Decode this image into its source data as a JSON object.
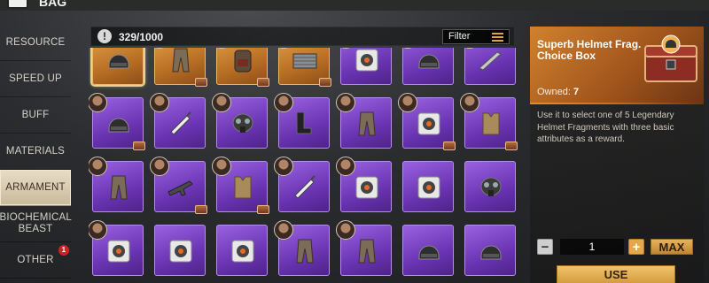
{
  "header": {
    "title_fragment": "BAG"
  },
  "sidebar": {
    "categories": [
      {
        "label": "RESOURCE",
        "active": false
      },
      {
        "label": "SPEED UP",
        "active": false
      },
      {
        "label": "BUFF",
        "active": false
      },
      {
        "label": "MATERIALS",
        "active": false
      },
      {
        "label": "ARMAMENT",
        "active": true
      },
      {
        "label": "BIOCHEMICAL BEAST",
        "active": false
      },
      {
        "label": "OTHER",
        "active": false,
        "badge": "1"
      }
    ]
  },
  "inventory": {
    "capacity": "329/1000",
    "filter_label": "Filter",
    "grid": {
      "rows": [
        [
          {
            "rarity": "orange",
            "item": "helmet-icon",
            "selected": true
          },
          {
            "rarity": "orange",
            "item": "trousers-icon",
            "hero": true,
            "chest": true
          },
          {
            "rarity": "orange",
            "item": "backpack-icon",
            "hero": true,
            "chest": true
          },
          {
            "rarity": "orange",
            "item": "crate-icon",
            "hero": true,
            "chest": true
          },
          {
            "rarity": "purple",
            "item": "fragment-box-icon",
            "hero": true
          },
          {
            "rarity": "purple",
            "item": "helmet-icon",
            "hero": true
          },
          {
            "rarity": "purple",
            "item": "blade-icon",
            "hero": true
          }
        ],
        [
          {
            "rarity": "purple",
            "item": "helmet-icon",
            "hero": true,
            "chest": true
          },
          {
            "rarity": "purple",
            "item": "syringe-icon",
            "hero": true
          },
          {
            "rarity": "purple",
            "item": "gas-mask-icon",
            "hero": true
          },
          {
            "rarity": "purple",
            "item": "boots-icon",
            "hero": true
          },
          {
            "rarity": "purple",
            "item": "trousers-icon",
            "hero": true
          },
          {
            "rarity": "purple",
            "item": "fragment-box-icon",
            "hero": true,
            "chest": true
          },
          {
            "rarity": "purple",
            "item": "vest-icon",
            "hero": true,
            "chest": true
          }
        ],
        [
          {
            "rarity": "purple",
            "item": "trousers-icon",
            "hero": true
          },
          {
            "rarity": "purple",
            "item": "rifle-icon",
            "hero": true,
            "chest": true
          },
          {
            "rarity": "purple",
            "item": "vest-icon",
            "hero": true,
            "chest": true
          },
          {
            "rarity": "purple",
            "item": "syringe-icon",
            "hero": true
          },
          {
            "rarity": "purple",
            "item": "fragment-box-icon",
            "hero": true
          },
          {
            "rarity": "purple",
            "item": "fragment-box-icon",
            "hero": false
          },
          {
            "rarity": "purple",
            "item": "gas-mask-icon",
            "hero": false
          }
        ],
        [
          {
            "rarity": "purple",
            "item": "fragment-box-icon",
            "hero": true
          },
          {
            "rarity": "purple",
            "item": "fragment-box-icon",
            "hero": false
          },
          {
            "rarity": "purple",
            "item": "fragment-box-icon",
            "hero": false
          },
          {
            "rarity": "purple",
            "item": "trousers-icon",
            "hero": true
          },
          {
            "rarity": "purple",
            "item": "trousers-icon",
            "hero": true
          },
          {
            "rarity": "purple",
            "item": "helmet-icon",
            "hero": false
          },
          {
            "rarity": "purple",
            "item": "helmet-icon",
            "hero": false
          }
        ]
      ]
    }
  },
  "detail": {
    "item_name": "Superb Helmet Frag. Choice Box",
    "owned_label": "Owned:",
    "owned_count": "7",
    "description": "Use it to select one of 5 Legendary Helmet Fragments with three basic attributes as a reward.",
    "quantity": "1",
    "minus_label": "−",
    "plus_label": "+",
    "max_label": "MAX",
    "use_label": "USE"
  },
  "colors": {
    "legendary": "#c87a2e",
    "epic": "#7a42c8",
    "accent": "#e4a84a"
  }
}
